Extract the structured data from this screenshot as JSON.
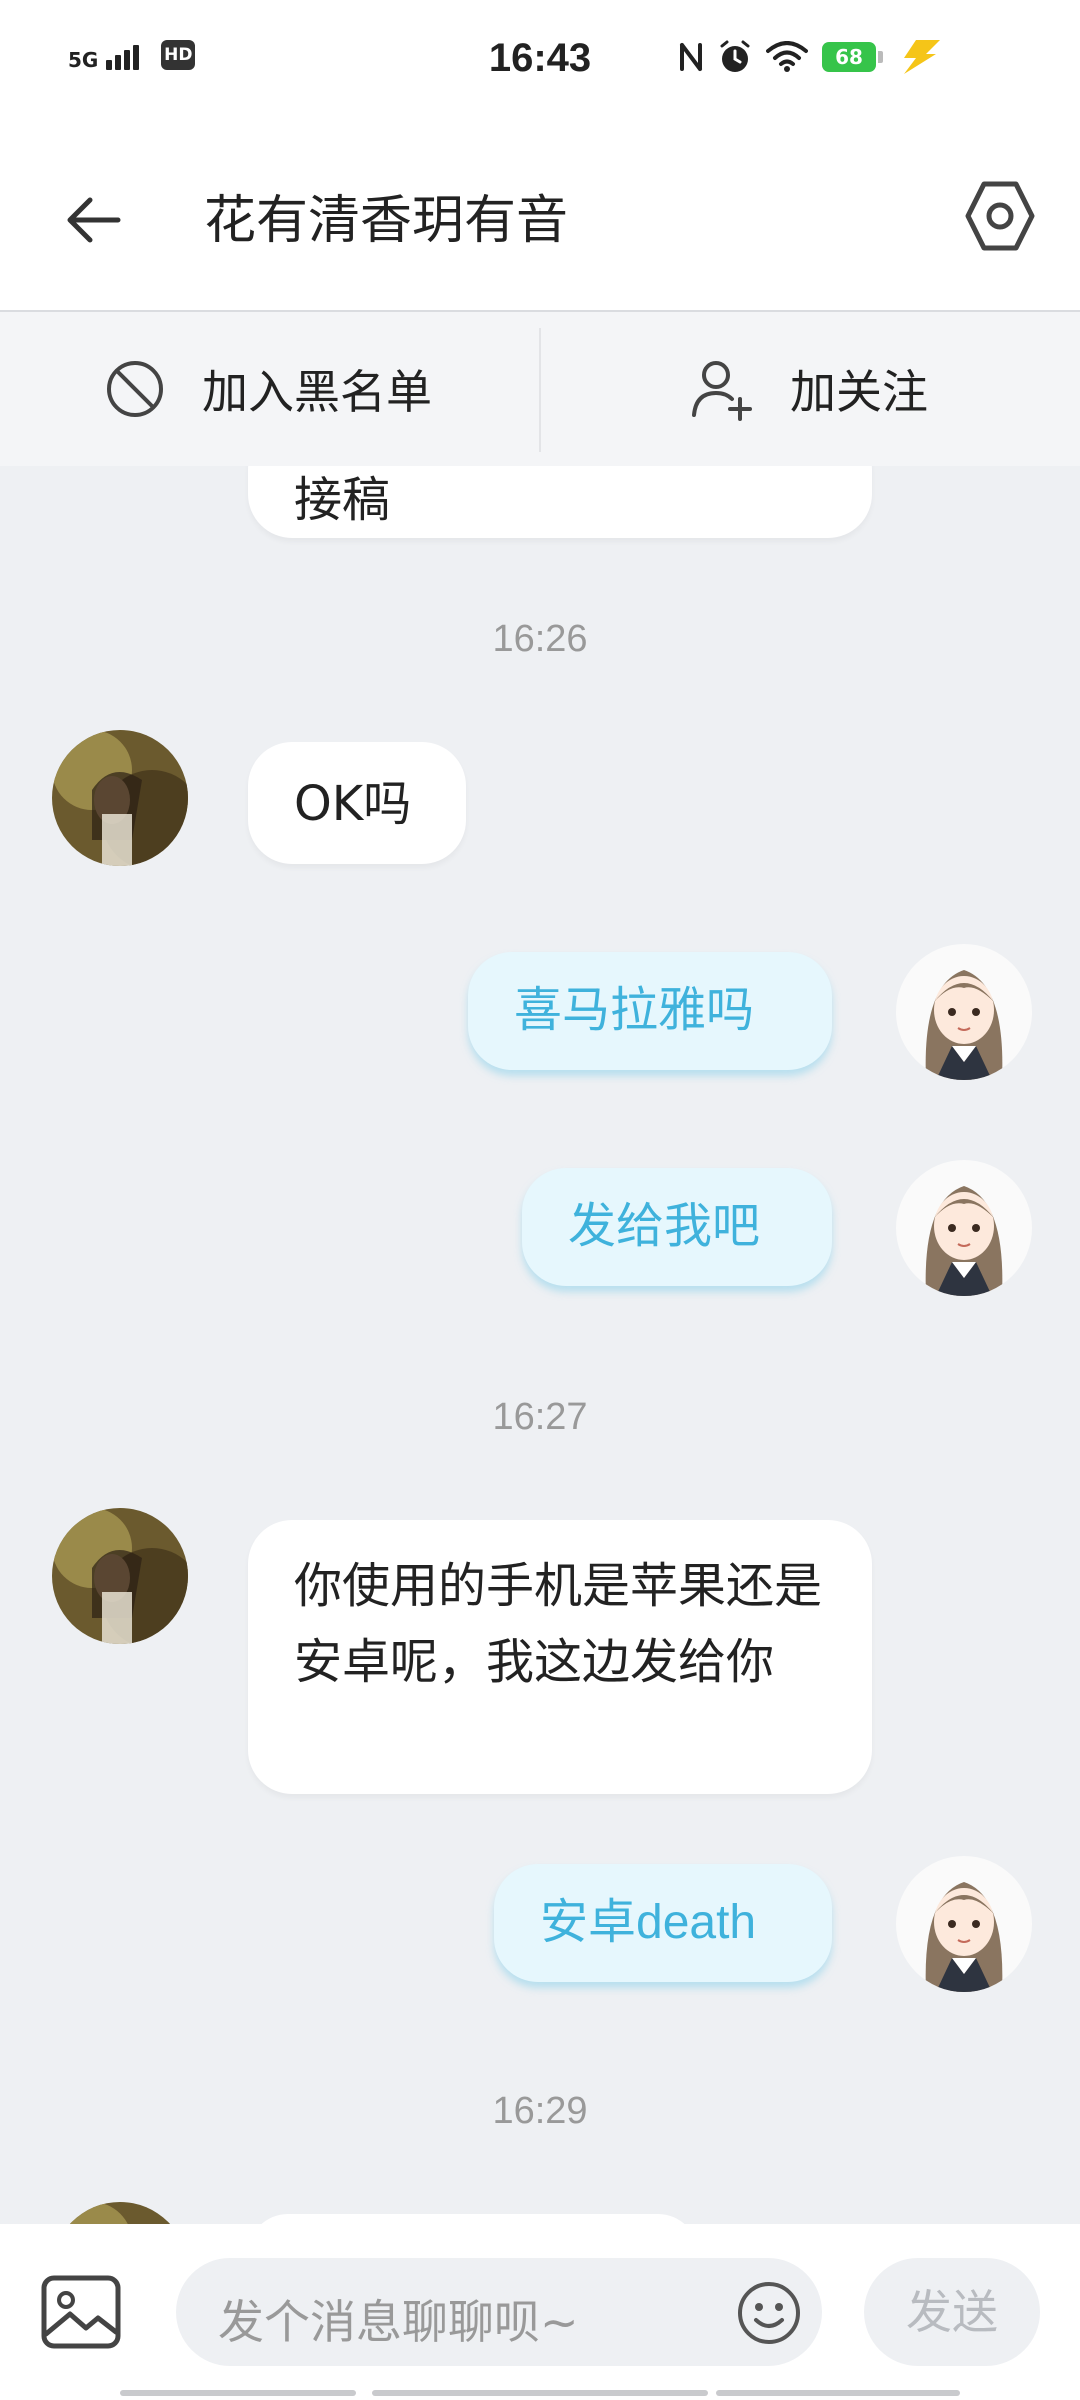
{
  "status_bar": {
    "time": "16:43",
    "network": "5G",
    "hd_badge": "HD",
    "battery": "68"
  },
  "header": {
    "title": "花有清香玥有音"
  },
  "actions": {
    "blacklist_label": "加入黑名单",
    "follow_label": "加关注"
  },
  "messages": [
    {
      "side": "in",
      "text": "接稿"
    },
    {
      "type": "timestamp",
      "text": "16:26"
    },
    {
      "side": "in",
      "text": "OK吗"
    },
    {
      "side": "out",
      "text": "喜马拉雅吗"
    },
    {
      "side": "out",
      "text": "发给我吧"
    },
    {
      "type": "timestamp",
      "text": "16:27"
    },
    {
      "side": "in",
      "text": "你使用的手机是苹果还是安卓呢，我这边发给你"
    },
    {
      "side": "out",
      "text": "安卓death"
    },
    {
      "type": "timestamp",
      "text": "16:29"
    }
  ],
  "input": {
    "placeholder": "发个消息聊聊呗~",
    "send_label": "发送"
  },
  "colors": {
    "outgoing_text": "#3fb2dc",
    "outgoing_bubble": "#e6f7fd",
    "chat_background": "#eef0f3"
  },
  "icons": [
    "back-arrow-icon",
    "settings-hexagon-icon",
    "block-icon",
    "add-user-icon",
    "image-icon",
    "emoji-icon"
  ]
}
